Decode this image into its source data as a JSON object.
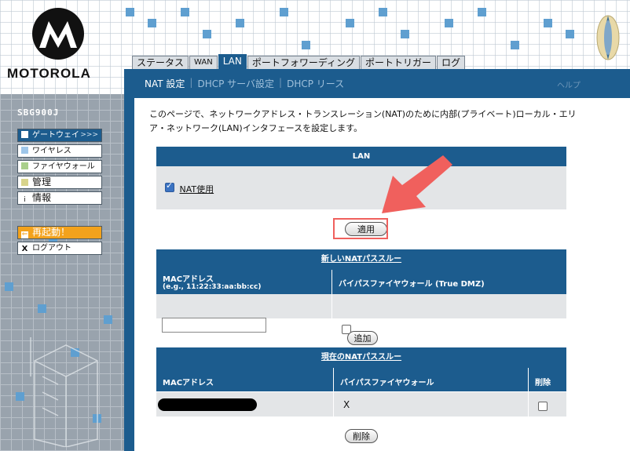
{
  "brand": {
    "name": "MOTOROLA"
  },
  "tabs": [
    {
      "label": "ステータス",
      "active": false
    },
    {
      "label": "WAN",
      "active": false
    },
    {
      "label": "LAN",
      "active": true
    },
    {
      "label": "ポートフォワーディング",
      "active": false
    },
    {
      "label": "ポートトリガー",
      "active": false
    },
    {
      "label": "ログ",
      "active": false
    }
  ],
  "subnav": {
    "items": [
      "NAT 設定",
      "DHCP サーバ設定",
      "DHCP リース"
    ],
    "help": "ヘルプ"
  },
  "sidebar": {
    "model": "SBG900J",
    "items": [
      {
        "label": "ゲートウェイ",
        "icon": "square-icon",
        "color": "#1c5c8e"
      },
      {
        "label": "ワイヤレス",
        "icon": "square-icon",
        "color": "#9fc7ea"
      },
      {
        "label": "ファイヤウォール",
        "icon": "square-icon",
        "color": "#a9cf8b"
      },
      {
        "label": "管理",
        "icon": "square-icon",
        "color": "#d8d48c"
      },
      {
        "label": "情報",
        "icon": "info-icon"
      },
      {
        "label": "再起動！",
        "icon": "restart-icon"
      },
      {
        "label": "ログアウト",
        "icon": "x-icon"
      }
    ],
    "active_chevron": ">>>"
  },
  "intro": "このページで、ネットワークアドレス・トランスレーション(NAT)のために内部(プライベート)ローカル・エリア・ネットワーク(LAN)インタフェースを設定します。",
  "lan": {
    "header": "LAN",
    "nat_label": "NAT使用",
    "nat_checked": true,
    "apply_label": "適用"
  },
  "new_pass": {
    "header": "新しいNATパススルー",
    "col_mac": "MACアドレス",
    "col_mac_hint": "(e.g., 11:22:33:aa:bb:cc)",
    "col_bypass": "バイパスファイヤウォール (True DMZ)",
    "mac_value": "",
    "add_label": "追加"
  },
  "current_pass": {
    "header": "現在のNATパススルー",
    "col_mac": "MACアドレス",
    "col_bypass": "バイパスファイヤウォール",
    "col_delete": "削除",
    "rows": [
      {
        "mac": "",
        "bypass": "X"
      }
    ],
    "delete_label": "削除"
  },
  "colors": {
    "accent": "#1c5c8e",
    "highlight": "#f0605d",
    "orange": "#f3a21c"
  }
}
